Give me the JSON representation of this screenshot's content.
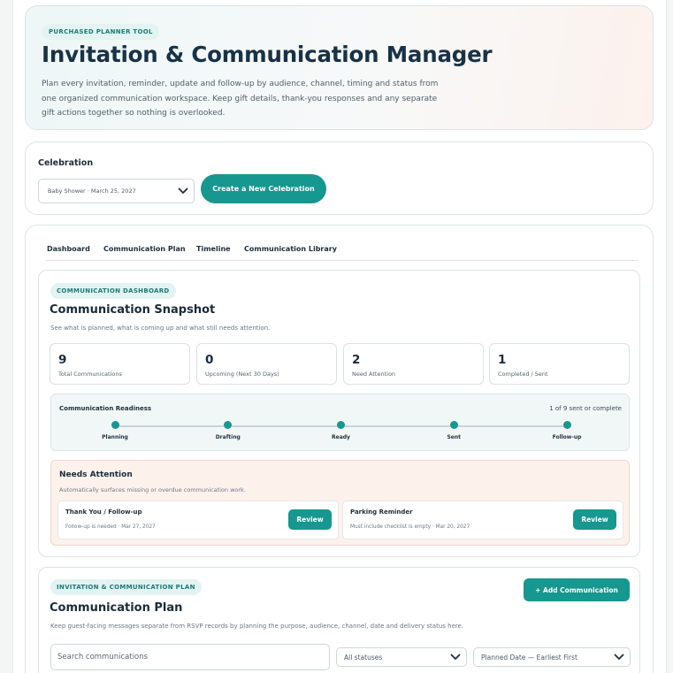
{
  "hero": {
    "badge": "PURCHASED PLANNER TOOL",
    "title": "Invitation & Communication Manager",
    "description": "Plan every invitation, reminder, update and follow-up by audience, channel, timing and status from one organized communication workspace. Keep gift details, thank-you responses and any separate gift actions together so nothing is overlooked."
  },
  "celebration": {
    "label": "Celebration",
    "selected": "Baby Shower · March 25, 2027",
    "create_button": "Create a New Celebration"
  },
  "tabs": [
    {
      "label": "Dashboard"
    },
    {
      "label": "Communication Plan"
    },
    {
      "label": "Timeline"
    },
    {
      "label": "Communication Library"
    }
  ],
  "dashboard": {
    "badge": "COMMUNICATION DASHBOARD",
    "title": "Communication Snapshot",
    "subtitle": "See what is planned, what is coming up and what still needs attention.",
    "stats": [
      {
        "value": "9",
        "label": "Total Communications"
      },
      {
        "value": "0",
        "label": "Upcoming (Next 30 Days)"
      },
      {
        "value": "2",
        "label": "Need Attention"
      },
      {
        "value": "1",
        "label": "Completed / Sent"
      }
    ],
    "readiness": {
      "title": "Communication Readiness",
      "count": "1 of 9 sent or complete",
      "steps": [
        "Planning",
        "Drafting",
        "Ready",
        "Sent",
        "Follow-up"
      ]
    },
    "attention": {
      "title": "Needs Attention",
      "subtitle": "Automatically surfaces missing or overdue communication work.",
      "items": [
        {
          "title": "Thank You / Follow-up",
          "meta": "Follow-up is needed · Mar 27, 2027",
          "button": "Review"
        },
        {
          "title": "Parking Reminder",
          "meta": "Must include checklist is empty · Mar 20, 2027",
          "button": "Review"
        }
      ]
    }
  },
  "plan": {
    "badge": "INVITATION & COMMUNICATION PLAN",
    "title": "Communication Plan",
    "subtitle": "Keep guest-facing messages separate from RSVP records by planning the purpose, audience, channel, date and delivery status here.",
    "add_button": "+ Add Communication",
    "search_placeholder": "Search communications",
    "status_filter": "All statuses",
    "sort": "Planned Date — Earliest First"
  },
  "colors": {
    "accent": "#16978f",
    "badge_bg": "#e2f3f1",
    "attention_bg": "#fdf1ec",
    "readiness_bg": "#f1f7f7"
  },
  "icons": {
    "dropdown": "chevron-down-icon"
  }
}
